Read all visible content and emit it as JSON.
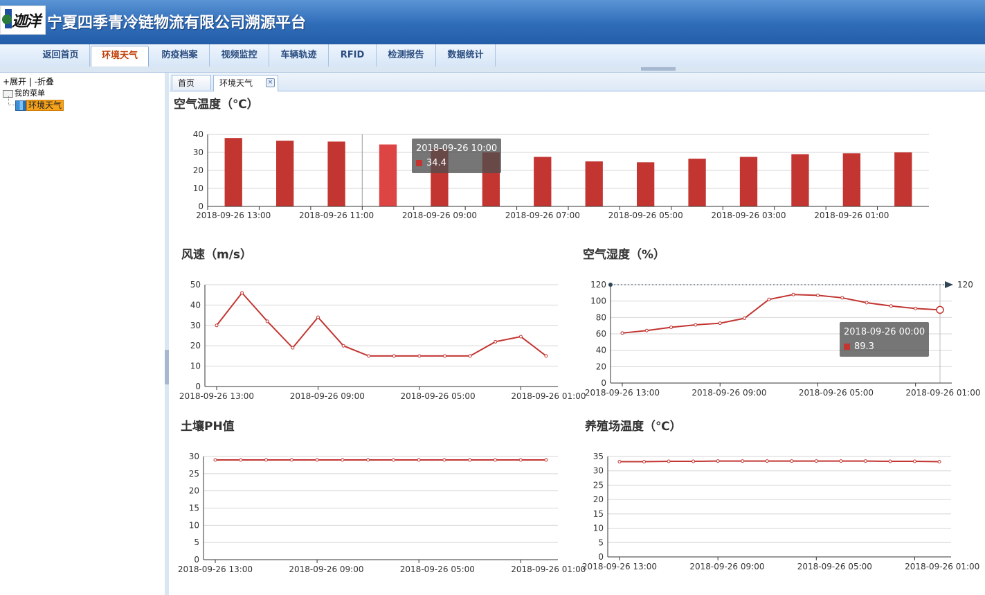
{
  "app": {
    "title": "宁夏四季青冷链物流有限公司溯源平台",
    "logo_script": "迦洋凡"
  },
  "nav": {
    "items": [
      {
        "label": "返回首页"
      },
      {
        "label": "环境天气",
        "active": true
      },
      {
        "label": "防疫档案"
      },
      {
        "label": "视频监控"
      },
      {
        "label": "车辆轨迹"
      },
      {
        "label": "RFID"
      },
      {
        "label": "检测报告"
      },
      {
        "label": "数据统计"
      }
    ]
  },
  "sidebar": {
    "toggle_text": "+展开 | -折叠",
    "root_label": "我的菜单",
    "leaf_label": "环境天气"
  },
  "tabs": {
    "home": "首页",
    "current": "环境天气",
    "close_glyph": "×"
  },
  "colors": {
    "series": "#c23531",
    "highlight": "#dd4444",
    "header_blue": "#2f6cb8"
  },
  "titles": {
    "air_temp": "空气温度（℃）",
    "wind": "风速（m/s）",
    "humidity": "空气湿度（%）",
    "ph": "土壤PH值",
    "farm_temp": "养殖场温度（℃）"
  },
  "tooltips": {
    "air_temp": {
      "x": "2018-09-26 10:00",
      "value": "34.4"
    },
    "humidity": {
      "x": "2018-09-26 00:00",
      "value": "89.3"
    }
  },
  "chart_data": [
    {
      "id": "air_temp",
      "type": "bar",
      "title": "空气温度（℃）",
      "categories": [
        "2018-09-26 13:00",
        "2018-09-26 12:00",
        "2018-09-26 11:00",
        "2018-09-26 10:00",
        "2018-09-26 09:00",
        "2018-09-26 08:00",
        "2018-09-26 07:00",
        "2018-09-26 06:00",
        "2018-09-26 05:00",
        "2018-09-26 04:00",
        "2018-09-26 03:00",
        "2018-09-26 02:00",
        "2018-09-26 01:00",
        "2018-09-26 00:00"
      ],
      "tick_labels": [
        "2018-09-26 13:00",
        "",
        "2018-09-26 11:00",
        "",
        "2018-09-26 09:00",
        "",
        "2018-09-26 07:00",
        "",
        "2018-09-26 05:00",
        "",
        "2018-09-26 03:00",
        "",
        "2018-09-26 01:00",
        ""
      ],
      "values": [
        38,
        36.5,
        36,
        34.4,
        32,
        30,
        27.5,
        25,
        24.5,
        26.5,
        27.5,
        29,
        29.5,
        30
      ],
      "ylim": [
        0,
        40
      ],
      "yticks": [
        0,
        10,
        20,
        30,
        40
      ],
      "highlight_index": 3,
      "grid": true
    },
    {
      "id": "wind",
      "type": "line",
      "title": "风速（m/s）",
      "categories": [
        "2018-09-26 13:00",
        "2018-09-26 12:00",
        "2018-09-26 11:00",
        "2018-09-26 10:00",
        "2018-09-26 09:00",
        "2018-09-26 08:00",
        "2018-09-26 07:00",
        "2018-09-26 06:00",
        "2018-09-26 05:00",
        "2018-09-26 04:00",
        "2018-09-26 03:00",
        "2018-09-26 02:00",
        "2018-09-26 01:00",
        "2018-09-26 00:00"
      ],
      "tick_labels": [
        "2018-09-26 13:00",
        "",
        "",
        "",
        "2018-09-26 09:00",
        "",
        "",
        "",
        "2018-09-26 05:00",
        "",
        "",
        "",
        "2018-09-26 01:00",
        ""
      ],
      "values": [
        30,
        46,
        32,
        19,
        34,
        20,
        15,
        15,
        15,
        15,
        15,
        22,
        24.5,
        15
      ],
      "ylim": [
        0,
        50
      ],
      "yticks": [
        0,
        10,
        20,
        30,
        40,
        50
      ],
      "grid": true
    },
    {
      "id": "humidity",
      "type": "line",
      "title": "空气湿度（%）",
      "categories": [
        "2018-09-26 13:00",
        "2018-09-26 12:00",
        "2018-09-26 11:00",
        "2018-09-26 10:00",
        "2018-09-26 09:00",
        "2018-09-26 08:00",
        "2018-09-26 07:00",
        "2018-09-26 06:00",
        "2018-09-26 05:00",
        "2018-09-26 04:00",
        "2018-09-26 03:00",
        "2018-09-26 02:00",
        "2018-09-26 01:00",
        "2018-09-26 00:00"
      ],
      "tick_labels": [
        "2018-09-26 13:00",
        "",
        "",
        "",
        "2018-09-26 09:00",
        "",
        "",
        "",
        "2018-09-26 05:00",
        "",
        "",
        "",
        "2018-09-26 01:00",
        ""
      ],
      "values": [
        61,
        64,
        68,
        71,
        73,
        79,
        102,
        108,
        107,
        104,
        98,
        94,
        91,
        89.3
      ],
      "ylim": [
        0,
        120
      ],
      "yticks": [
        0,
        20,
        40,
        60,
        80,
        100,
        120
      ],
      "grid": true,
      "markline": {
        "value": 120,
        "label": "120"
      },
      "highlight_index": 13
    },
    {
      "id": "ph",
      "type": "line",
      "title": "土壤PH值",
      "categories": [
        "2018-09-26 13:00",
        "2018-09-26 12:00",
        "2018-09-26 11:00",
        "2018-09-26 10:00",
        "2018-09-26 09:00",
        "2018-09-26 08:00",
        "2018-09-26 07:00",
        "2018-09-26 06:00",
        "2018-09-26 05:00",
        "2018-09-26 04:00",
        "2018-09-26 03:00",
        "2018-09-26 02:00",
        "2018-09-26 01:00",
        "2018-09-26 00:00"
      ],
      "tick_labels": [
        "2018-09-26 13:00",
        "",
        "",
        "",
        "2018-09-26 09:00",
        "",
        "",
        "",
        "2018-09-26 05:00",
        "",
        "",
        "",
        "2018-09-26 01:00",
        ""
      ],
      "values": [
        29,
        29,
        29,
        29,
        29,
        29,
        29,
        29,
        29,
        29,
        29,
        29,
        29,
        29
      ],
      "ylim": [
        0,
        30
      ],
      "yticks": [
        0,
        5,
        10,
        15,
        20,
        25,
        30
      ],
      "grid": true
    },
    {
      "id": "farm_temp",
      "type": "line",
      "title": "养殖场温度（℃）",
      "categories": [
        "2018-09-26 13:00",
        "2018-09-26 12:00",
        "2018-09-26 11:00",
        "2018-09-26 10:00",
        "2018-09-26 09:00",
        "2018-09-26 08:00",
        "2018-09-26 07:00",
        "2018-09-26 06:00",
        "2018-09-26 05:00",
        "2018-09-26 04:00",
        "2018-09-26 03:00",
        "2018-09-26 02:00",
        "2018-09-26 01:00",
        "2018-09-26 00:00"
      ],
      "tick_labels": [
        "2018-09-26 13:00",
        "",
        "",
        "",
        "2018-09-26 09:00",
        "",
        "",
        "",
        "2018-09-26 05:00",
        "",
        "",
        "",
        "2018-09-26 01:00",
        ""
      ],
      "values": [
        33.2,
        33.2,
        33.3,
        33.3,
        33.4,
        33.4,
        33.4,
        33.4,
        33.4,
        33.4,
        33.4,
        33.3,
        33.3,
        33.2
      ],
      "ylim": [
        0,
        35
      ],
      "yticks": [
        0,
        5,
        10,
        15,
        20,
        25,
        30,
        35
      ],
      "grid": true
    }
  ]
}
